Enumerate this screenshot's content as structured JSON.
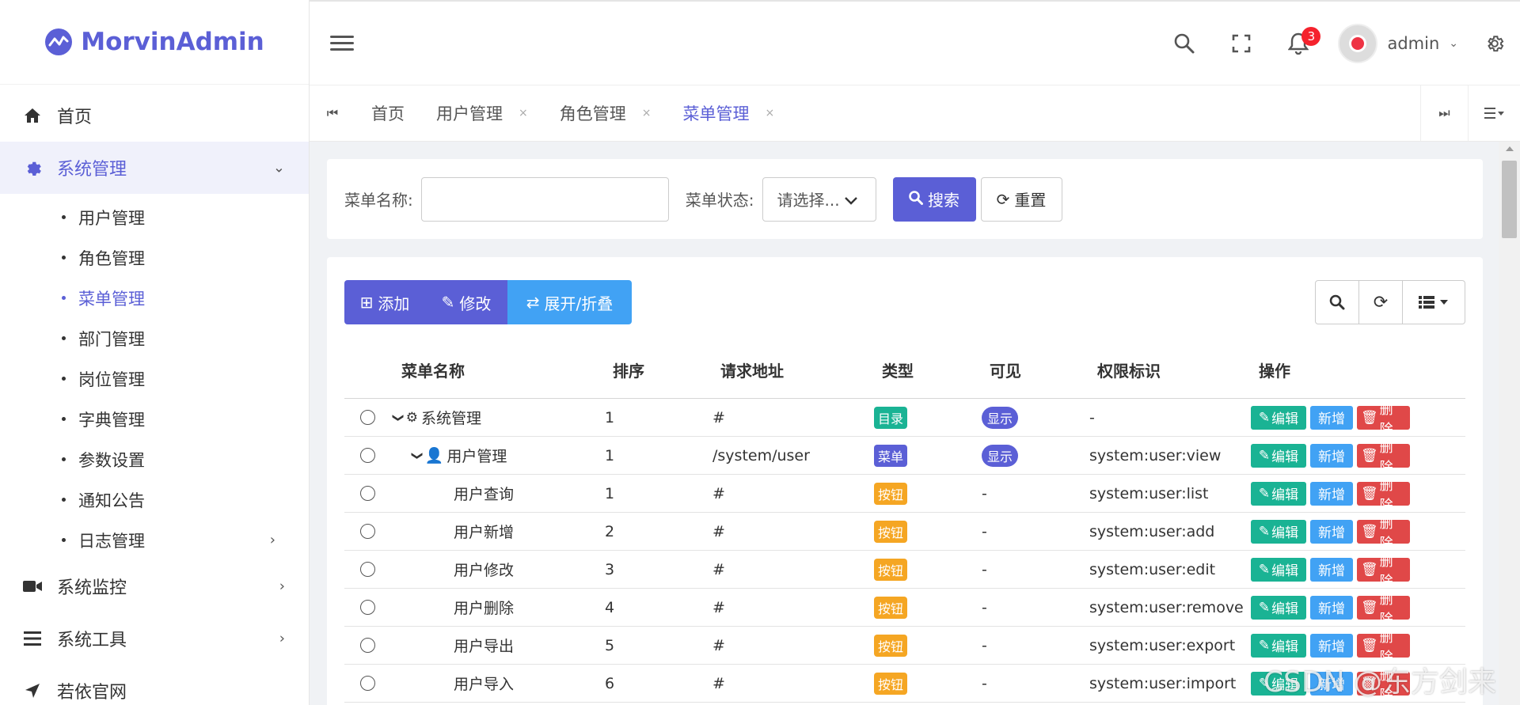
{
  "app": {
    "title": "MorvinAdmin"
  },
  "sidebar": {
    "items": [
      {
        "label": "首页",
        "icon": "home-icon"
      },
      {
        "label": "系统管理",
        "icon": "gear-icon",
        "expanded": true
      },
      {
        "label": "系统监控",
        "icon": "video-icon"
      },
      {
        "label": "系统工具",
        "icon": "bars-icon"
      },
      {
        "label": "若依官网",
        "icon": "location-arrow-icon"
      }
    ],
    "sub_items": [
      "用户管理",
      "角色管理",
      "菜单管理",
      "部门管理",
      "岗位管理",
      "字典管理",
      "参数设置",
      "通知公告",
      "日志管理"
    ],
    "active_sub": "菜单管理"
  },
  "header": {
    "notification_count": "3",
    "user_name": "admin"
  },
  "tabs": [
    {
      "label": "首页"
    },
    {
      "label": "用户管理",
      "close": "×"
    },
    {
      "label": "角色管理",
      "close": "×"
    },
    {
      "label": "菜单管理",
      "close": "×",
      "active": true
    }
  ],
  "search": {
    "name_label": "菜单名称:",
    "name_value": "",
    "status_label": "菜单状态:",
    "status_placeholder": "请选择...",
    "search_button": "搜索",
    "reset_button": "重置"
  },
  "toolbar": {
    "add": "添加",
    "edit": "修改",
    "toggle": "展开/折叠"
  },
  "table": {
    "headers": [
      "菜单名称",
      "排序",
      "请求地址",
      "类型",
      "可见",
      "权限标识",
      "操作"
    ],
    "rows": [
      {
        "name": "系统管理",
        "order": "1",
        "url": "#",
        "type": "目录",
        "visible": "显示",
        "perm": "-"
      },
      {
        "name": "用户管理",
        "order": "1",
        "url": "/system/user",
        "type": "菜单",
        "visible": "显示",
        "perm": "system:user:view"
      },
      {
        "name": "用户查询",
        "order": "1",
        "url": "#",
        "type": "按钮",
        "visible": "-",
        "perm": "system:user:list"
      },
      {
        "name": "用户新增",
        "order": "2",
        "url": "#",
        "type": "按钮",
        "visible": "-",
        "perm": "system:user:add"
      },
      {
        "name": "用户修改",
        "order": "3",
        "url": "#",
        "type": "按钮",
        "visible": "-",
        "perm": "system:user:edit"
      },
      {
        "name": "用户删除",
        "order": "4",
        "url": "#",
        "type": "按钮",
        "visible": "-",
        "perm": "system:user:remove"
      },
      {
        "name": "用户导出",
        "order": "5",
        "url": "#",
        "type": "按钮",
        "visible": "-",
        "perm": "system:user:export"
      },
      {
        "name": "用户导入",
        "order": "6",
        "url": "#",
        "type": "按钮",
        "visible": "-",
        "perm": "system:user:import"
      }
    ],
    "op_edit": "编辑",
    "op_add": "新增",
    "op_delete": "删除"
  },
  "watermark": "CSDN @东方剑来",
  "colors": {
    "primary": "#5b5fd6",
    "info": "#41a2f4",
    "success": "#1ab394",
    "warning": "#f5a623",
    "danger": "#e04848"
  }
}
